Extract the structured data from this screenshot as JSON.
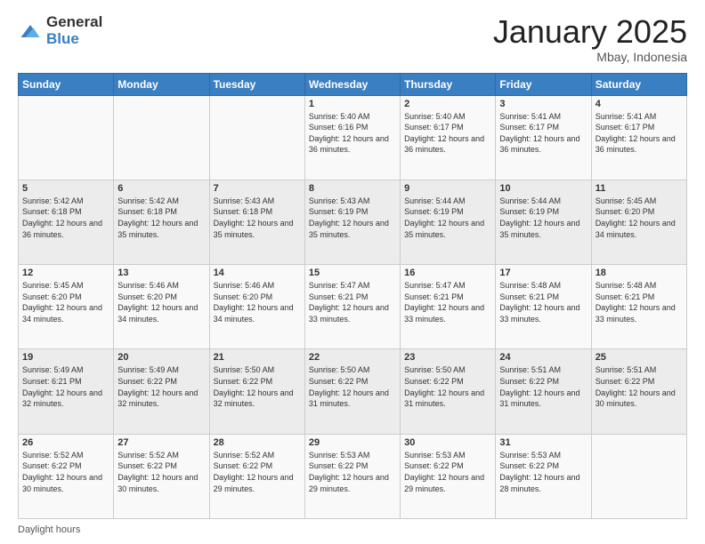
{
  "logo": {
    "general": "General",
    "blue": "Blue"
  },
  "header": {
    "month": "January 2025",
    "location": "Mbay, Indonesia"
  },
  "days_of_week": [
    "Sunday",
    "Monday",
    "Tuesday",
    "Wednesday",
    "Thursday",
    "Friday",
    "Saturday"
  ],
  "weeks": [
    [
      {
        "day": "",
        "sunrise": "",
        "sunset": "",
        "daylight": ""
      },
      {
        "day": "",
        "sunrise": "",
        "sunset": "",
        "daylight": ""
      },
      {
        "day": "",
        "sunrise": "",
        "sunset": "",
        "daylight": ""
      },
      {
        "day": "1",
        "sunrise": "Sunrise: 5:40 AM",
        "sunset": "Sunset: 6:16 PM",
        "daylight": "Daylight: 12 hours and 36 minutes."
      },
      {
        "day": "2",
        "sunrise": "Sunrise: 5:40 AM",
        "sunset": "Sunset: 6:17 PM",
        "daylight": "Daylight: 12 hours and 36 minutes."
      },
      {
        "day": "3",
        "sunrise": "Sunrise: 5:41 AM",
        "sunset": "Sunset: 6:17 PM",
        "daylight": "Daylight: 12 hours and 36 minutes."
      },
      {
        "day": "4",
        "sunrise": "Sunrise: 5:41 AM",
        "sunset": "Sunset: 6:17 PM",
        "daylight": "Daylight: 12 hours and 36 minutes."
      }
    ],
    [
      {
        "day": "5",
        "sunrise": "Sunrise: 5:42 AM",
        "sunset": "Sunset: 6:18 PM",
        "daylight": "Daylight: 12 hours and 36 minutes."
      },
      {
        "day": "6",
        "sunrise": "Sunrise: 5:42 AM",
        "sunset": "Sunset: 6:18 PM",
        "daylight": "Daylight: 12 hours and 35 minutes."
      },
      {
        "day": "7",
        "sunrise": "Sunrise: 5:43 AM",
        "sunset": "Sunset: 6:18 PM",
        "daylight": "Daylight: 12 hours and 35 minutes."
      },
      {
        "day": "8",
        "sunrise": "Sunrise: 5:43 AM",
        "sunset": "Sunset: 6:19 PM",
        "daylight": "Daylight: 12 hours and 35 minutes."
      },
      {
        "day": "9",
        "sunrise": "Sunrise: 5:44 AM",
        "sunset": "Sunset: 6:19 PM",
        "daylight": "Daylight: 12 hours and 35 minutes."
      },
      {
        "day": "10",
        "sunrise": "Sunrise: 5:44 AM",
        "sunset": "Sunset: 6:19 PM",
        "daylight": "Daylight: 12 hours and 35 minutes."
      },
      {
        "day": "11",
        "sunrise": "Sunrise: 5:45 AM",
        "sunset": "Sunset: 6:20 PM",
        "daylight": "Daylight: 12 hours and 34 minutes."
      }
    ],
    [
      {
        "day": "12",
        "sunrise": "Sunrise: 5:45 AM",
        "sunset": "Sunset: 6:20 PM",
        "daylight": "Daylight: 12 hours and 34 minutes."
      },
      {
        "day": "13",
        "sunrise": "Sunrise: 5:46 AM",
        "sunset": "Sunset: 6:20 PM",
        "daylight": "Daylight: 12 hours and 34 minutes."
      },
      {
        "day": "14",
        "sunrise": "Sunrise: 5:46 AM",
        "sunset": "Sunset: 6:20 PM",
        "daylight": "Daylight: 12 hours and 34 minutes."
      },
      {
        "day": "15",
        "sunrise": "Sunrise: 5:47 AM",
        "sunset": "Sunset: 6:21 PM",
        "daylight": "Daylight: 12 hours and 33 minutes."
      },
      {
        "day": "16",
        "sunrise": "Sunrise: 5:47 AM",
        "sunset": "Sunset: 6:21 PM",
        "daylight": "Daylight: 12 hours and 33 minutes."
      },
      {
        "day": "17",
        "sunrise": "Sunrise: 5:48 AM",
        "sunset": "Sunset: 6:21 PM",
        "daylight": "Daylight: 12 hours and 33 minutes."
      },
      {
        "day": "18",
        "sunrise": "Sunrise: 5:48 AM",
        "sunset": "Sunset: 6:21 PM",
        "daylight": "Daylight: 12 hours and 33 minutes."
      }
    ],
    [
      {
        "day": "19",
        "sunrise": "Sunrise: 5:49 AM",
        "sunset": "Sunset: 6:21 PM",
        "daylight": "Daylight: 12 hours and 32 minutes."
      },
      {
        "day": "20",
        "sunrise": "Sunrise: 5:49 AM",
        "sunset": "Sunset: 6:22 PM",
        "daylight": "Daylight: 12 hours and 32 minutes."
      },
      {
        "day": "21",
        "sunrise": "Sunrise: 5:50 AM",
        "sunset": "Sunset: 6:22 PM",
        "daylight": "Daylight: 12 hours and 32 minutes."
      },
      {
        "day": "22",
        "sunrise": "Sunrise: 5:50 AM",
        "sunset": "Sunset: 6:22 PM",
        "daylight": "Daylight: 12 hours and 31 minutes."
      },
      {
        "day": "23",
        "sunrise": "Sunrise: 5:50 AM",
        "sunset": "Sunset: 6:22 PM",
        "daylight": "Daylight: 12 hours and 31 minutes."
      },
      {
        "day": "24",
        "sunrise": "Sunrise: 5:51 AM",
        "sunset": "Sunset: 6:22 PM",
        "daylight": "Daylight: 12 hours and 31 minutes."
      },
      {
        "day": "25",
        "sunrise": "Sunrise: 5:51 AM",
        "sunset": "Sunset: 6:22 PM",
        "daylight": "Daylight: 12 hours and 30 minutes."
      }
    ],
    [
      {
        "day": "26",
        "sunrise": "Sunrise: 5:52 AM",
        "sunset": "Sunset: 6:22 PM",
        "daylight": "Daylight: 12 hours and 30 minutes."
      },
      {
        "day": "27",
        "sunrise": "Sunrise: 5:52 AM",
        "sunset": "Sunset: 6:22 PM",
        "daylight": "Daylight: 12 hours and 30 minutes."
      },
      {
        "day": "28",
        "sunrise": "Sunrise: 5:52 AM",
        "sunset": "Sunset: 6:22 PM",
        "daylight": "Daylight: 12 hours and 29 minutes."
      },
      {
        "day": "29",
        "sunrise": "Sunrise: 5:53 AM",
        "sunset": "Sunset: 6:22 PM",
        "daylight": "Daylight: 12 hours and 29 minutes."
      },
      {
        "day": "30",
        "sunrise": "Sunrise: 5:53 AM",
        "sunset": "Sunset: 6:22 PM",
        "daylight": "Daylight: 12 hours and 29 minutes."
      },
      {
        "day": "31",
        "sunrise": "Sunrise: 5:53 AM",
        "sunset": "Sunset: 6:22 PM",
        "daylight": "Daylight: 12 hours and 28 minutes."
      },
      {
        "day": "",
        "sunrise": "",
        "sunset": "",
        "daylight": ""
      }
    ]
  ],
  "footer": {
    "daylight_label": "Daylight hours"
  }
}
